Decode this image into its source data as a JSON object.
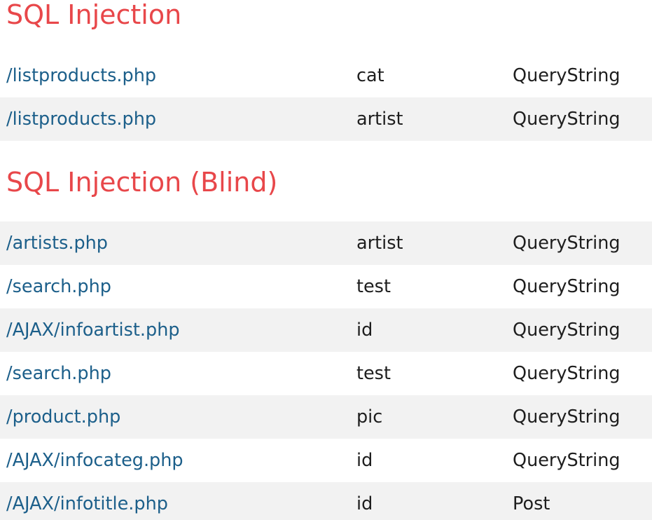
{
  "sections": [
    {
      "title": "SQL Injection",
      "rows": [
        {
          "url": "/listproducts.php",
          "parameter": "cat",
          "type": "QueryString"
        },
        {
          "url": "/listproducts.php",
          "parameter": "artist",
          "type": "QueryString"
        }
      ]
    },
    {
      "title": "SQL Injection (Blind)",
      "rows": [
        {
          "url": "/artists.php",
          "parameter": "artist",
          "type": "QueryString"
        },
        {
          "url": "/search.php",
          "parameter": "test",
          "type": "QueryString"
        },
        {
          "url": "/AJAX/infoartist.php",
          "parameter": "id",
          "type": "QueryString"
        },
        {
          "url": "/search.php",
          "parameter": "test",
          "type": "QueryString"
        },
        {
          "url": "/product.php",
          "parameter": "pic",
          "type": "QueryString"
        },
        {
          "url": "/AJAX/infocateg.php",
          "parameter": "id",
          "type": "QueryString"
        },
        {
          "url": "/AJAX/infotitle.php",
          "parameter": "id",
          "type": "Post"
        }
      ]
    }
  ],
  "colors": {
    "title": "#e8474a",
    "link": "#1c5f8a",
    "text": "#1e1e1e",
    "row_shade": "#f2f2f2"
  }
}
